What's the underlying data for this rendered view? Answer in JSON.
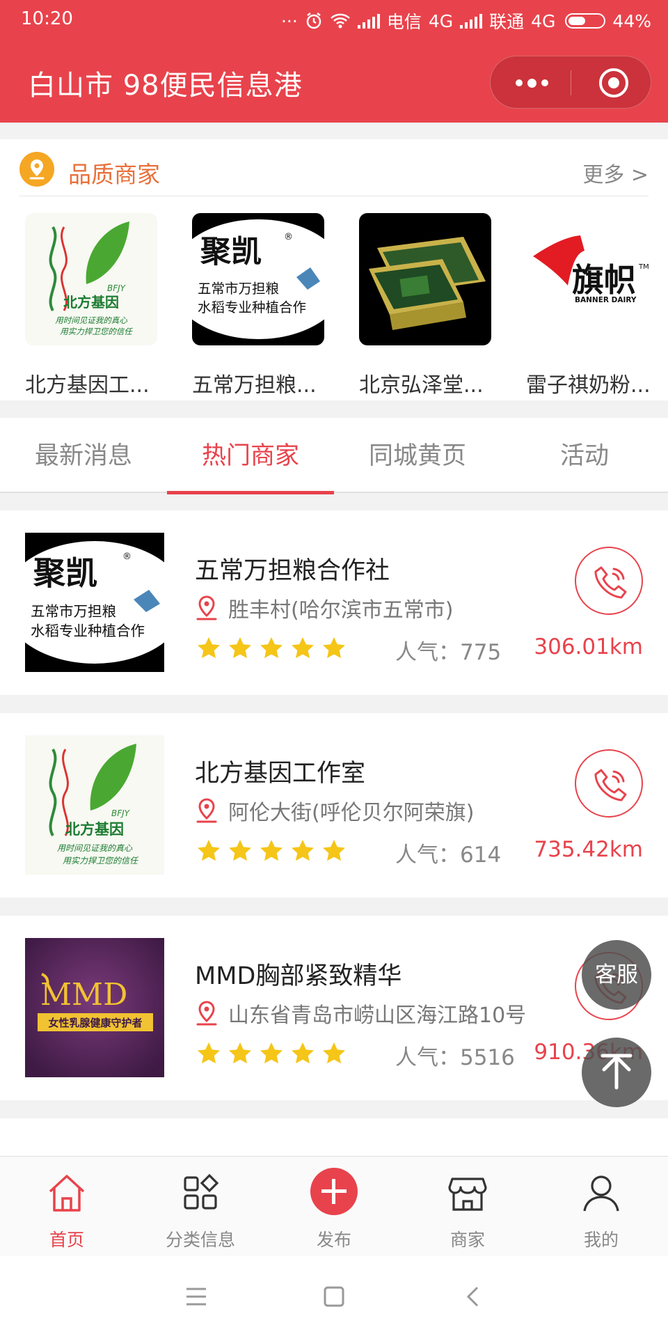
{
  "status_bar": {
    "time": "10:20",
    "carrier1": "电信",
    "net1": "4G",
    "carrier2": "联通",
    "net2": "4G",
    "battery": "44%"
  },
  "header": {
    "title": "白山市 98便民信息港"
  },
  "quality": {
    "title": "品质商家",
    "more": "更多 >",
    "items": [
      {
        "name": "北方基因工...",
        "logo": {
          "main": "北方基因",
          "sub": "BFJY",
          "line1": "用时间见证我的真心",
          "line2": "用实力捍卫您的信任"
        }
      },
      {
        "name": "五常万担粮...",
        "logo": {
          "main": "聚凯",
          "reg": "®",
          "line1": "五常市万担粮",
          "line2": "水稻专业种植合作"
        }
      },
      {
        "name": "北京弘泽堂..."
      },
      {
        "name": "雷子祺奶粉...",
        "logo": {
          "main": "旗帜",
          "tm": "TM",
          "sub": "BANNER DAIRY"
        }
      }
    ]
  },
  "tabs": [
    "最新消息",
    "热门商家",
    "同城黄页",
    "活动"
  ],
  "merchants": [
    {
      "name": "五常万担粮合作社",
      "location": "胜丰村(哈尔滨市五常市)",
      "popularity": "人气：775",
      "distance": "306.01km",
      "rating": 5,
      "logo": {
        "main": "聚凯",
        "reg": "®",
        "line1": "五常市万担粮",
        "line2": "水稻专业种植合作"
      }
    },
    {
      "name": "北方基因工作室",
      "location": "阿伦大街(呼伦贝尔阿荣旗)",
      "popularity": "人气：614",
      "distance": "735.42km",
      "rating": 5,
      "logo": {
        "main": "北方基因",
        "sub": "BFJY",
        "line1": "用时间见证我的真心",
        "line2": "用实力捍卫您的信任"
      }
    },
    {
      "name": "MMD胸部紧致精华",
      "location": "山东省青岛市崂山区海江路10号",
      "popularity": "人气：5516",
      "distance": "910.36km",
      "rating": 5,
      "logo": {
        "main": "MMD",
        "sub": "女性乳腺健康守护者"
      }
    }
  ],
  "floating": {
    "service": "客服"
  },
  "tabbar": [
    {
      "label": "首页",
      "icon": "home-icon"
    },
    {
      "label": "分类信息",
      "icon": "category-icon"
    },
    {
      "label": "发布",
      "icon": "plus-icon"
    },
    {
      "label": "商家",
      "icon": "shop-icon"
    },
    {
      "label": "我的",
      "icon": "user-icon"
    }
  ],
  "colors": {
    "primary": "#e8434c",
    "star": "#f5c518",
    "accent": "#e8703a"
  }
}
